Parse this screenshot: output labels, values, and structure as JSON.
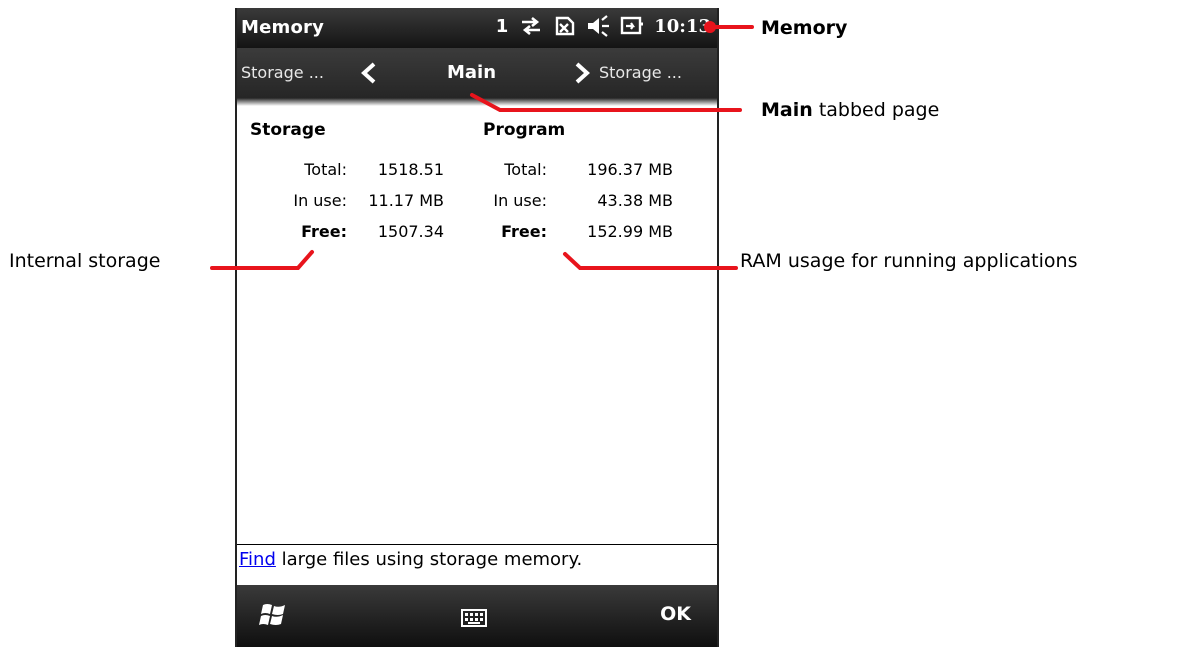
{
  "title_bar": {
    "title": "Memory",
    "notification_count": "1",
    "time": "10:13",
    "icons": [
      "sync-icon",
      "no-sim-icon",
      "speaker-muted-icon",
      "battery-charging-icon"
    ]
  },
  "tabs": {
    "previous": "Storage ...",
    "current": "Main",
    "next": "Storage ..."
  },
  "storage": {
    "heading": "Storage",
    "total_label": "Total:",
    "total_value": "1518.51",
    "in_use_label": "In use:",
    "in_use_value": "11.17 MB",
    "free_label": "Free:",
    "free_value": "1507.34"
  },
  "program": {
    "heading": "Program",
    "total_label": "Total:",
    "total_value": "196.37 MB",
    "in_use_label": "In use:",
    "in_use_value": "43.38 MB",
    "free_label": "Free:",
    "free_value": "152.99 MB"
  },
  "footer": {
    "link_text": "Find",
    "rest_text": " large files using storage memory."
  },
  "softkeys": {
    "right": "OK",
    "left_icon": "windows-start-icon",
    "center_icon": "keyboard-icon"
  },
  "callouts": {
    "memory": "Memory",
    "main_bold": "Main",
    "main_rest": " tabbed page",
    "internal": "Internal storage",
    "ram": "RAM usage for running applications"
  },
  "colors": {
    "callout_line": "#e8141c",
    "link": "#0000ee"
  }
}
